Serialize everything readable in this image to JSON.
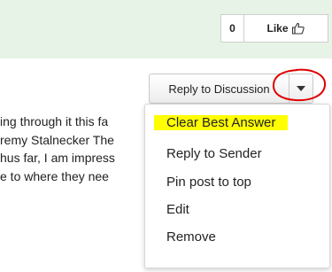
{
  "like": {
    "count": "0",
    "label": "Like",
    "icon": "thumbs-up-icon"
  },
  "reply": {
    "label": "Reply to Discussion",
    "caret_icon": "caret-down-icon"
  },
  "post": {
    "lines": [
      "ing through it this fa",
      "remy Stalnecker The",
      "hus far, I am impress",
      "e to where they nee"
    ]
  },
  "menu": {
    "items": [
      "Clear Best Answer",
      "Reply to Sender",
      "Pin post to top",
      "Edit",
      "Remove"
    ]
  },
  "colors": {
    "topbar": "#e7f3e6",
    "highlight": "#ffff00",
    "annotation": "#e00000"
  }
}
